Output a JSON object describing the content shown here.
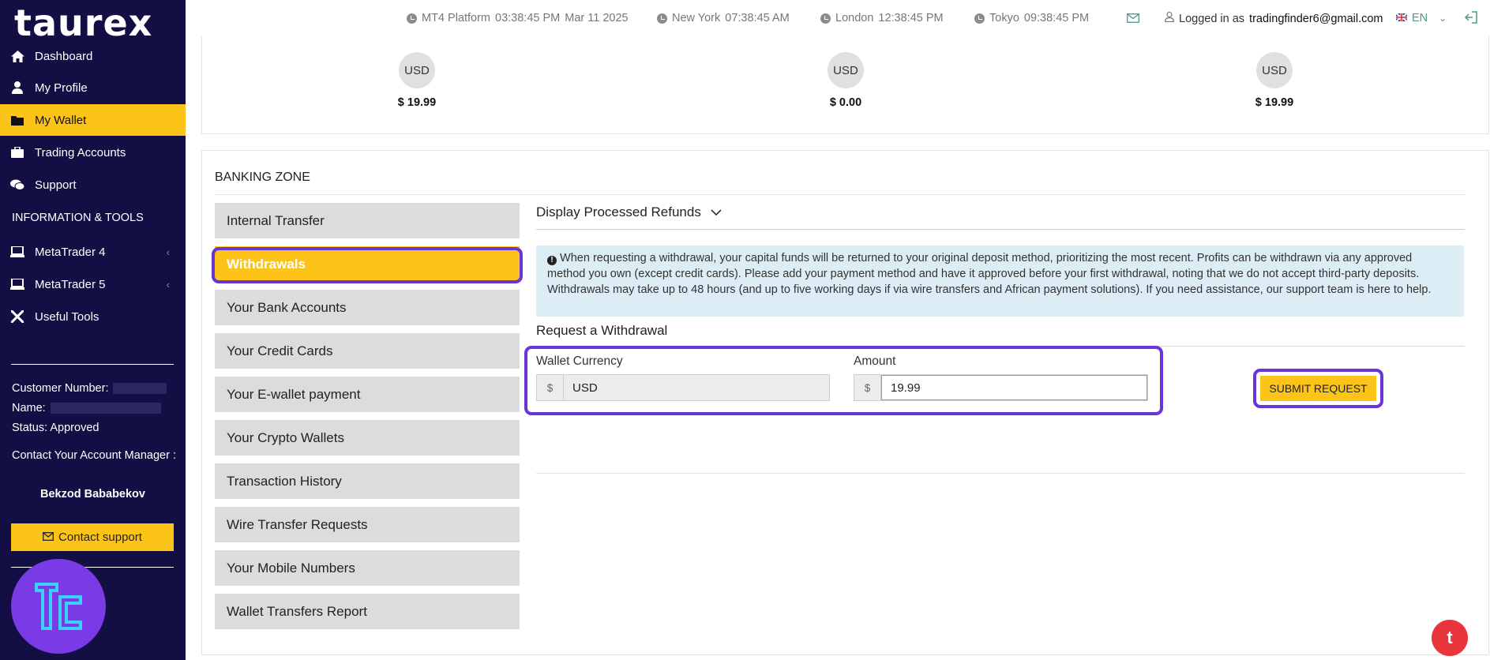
{
  "app": {
    "logo": "taurex"
  },
  "header": {
    "platform_label": "MT4 Platform",
    "platform_time": "03:38:45 PM",
    "platform_date": "Mar 11 2025",
    "clocks": [
      {
        "city": "New York",
        "time": "07:38:45 AM"
      },
      {
        "city": "London",
        "time": "12:38:45 PM"
      },
      {
        "city": "Tokyo",
        "time": "09:38:45 PM"
      }
    ],
    "logged_in_prefix": "Logged in as",
    "user_email": "tradingfinder6@gmail.com",
    "language": "EN"
  },
  "sidebar": {
    "items": [
      {
        "label": "Dashboard",
        "icon": "home-icon"
      },
      {
        "label": "My Profile",
        "icon": "user-icon"
      },
      {
        "label": "My Wallet",
        "icon": "folder-icon",
        "active": true
      },
      {
        "label": "Trading Accounts",
        "icon": "briefcase-icon"
      },
      {
        "label": "Support",
        "icon": "chat-icon"
      }
    ],
    "section_title": "INFORMATION & TOOLS",
    "tools": [
      {
        "label": "MetaTrader 4",
        "icon": "laptop-icon"
      },
      {
        "label": "MetaTrader 5",
        "icon": "laptop-icon"
      },
      {
        "label": "Useful Tools",
        "icon": "tools-icon"
      }
    ],
    "customer_number_label": "Customer Number:",
    "name_label": "Name:",
    "status_label": "Status:",
    "status_value": "Approved",
    "manager_label": "Contact Your Account Manager :",
    "manager_name": "Bekzod Bababekov",
    "contact_button": "Contact support"
  },
  "balances": [
    {
      "currency": "USD",
      "amount": "$ 19.99"
    },
    {
      "currency": "USD",
      "amount": "$ 0.00"
    },
    {
      "currency": "USD",
      "amount": "$ 19.99"
    }
  ],
  "banking": {
    "title": "BANKING ZONE",
    "menu": [
      "Internal Transfer",
      "Withdrawals",
      "Your Bank Accounts",
      "Your Credit Cards",
      "Your E-wallet payment",
      "Your Crypto Wallets",
      "Transaction History",
      "Wire Transfer Requests",
      "Your Mobile Numbers",
      "Wallet Transfers Report"
    ],
    "active_menu": "Withdrawals",
    "refunds_toggle": "Display Processed Refunds",
    "info_text": "When requesting a withdrawal, your capital funds will be returned to your original deposit method, prioritizing the most recent. Profits can be withdrawn via any approved method you own (except credit cards). Please add your payment method and have it approved before your first withdrawal, noting that we do not accept third-party deposits. Withdrawals may take up to 48 hours (and up to five working days if via wire transfers and African payment solutions). If you need assistance, our support team is here to help.",
    "request_title": "Request a Withdrawal",
    "wallet_currency_label": "Wallet Currency",
    "wallet_currency_value": "USD",
    "amount_label": "Amount",
    "amount_value": "19.99",
    "currency_symbol": "$",
    "submit_label": "SUBMIT REQUEST"
  },
  "colors": {
    "sidebar_bg": "#130f44",
    "accent": "#fcc419",
    "highlight": "#6a35d8",
    "info_bg": "#dcedf5"
  },
  "chat_fab_label": "t"
}
